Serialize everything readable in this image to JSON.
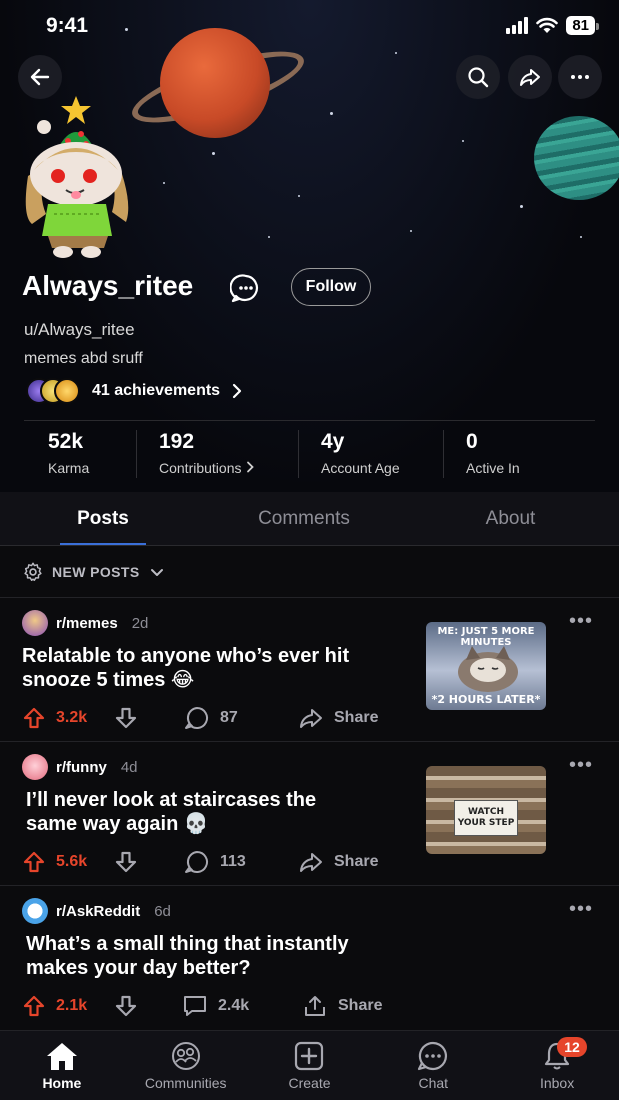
{
  "status_bar": {
    "time": "9:41",
    "battery": "81"
  },
  "profile": {
    "username": "Always_ritee",
    "handle": "u/Always_ritee",
    "bio": "memes abd sruff",
    "achievements_label": "41 achievements",
    "follow_label": "Follow"
  },
  "stats": [
    {
      "value": "52k",
      "label": "Karma"
    },
    {
      "value": "192",
      "label": "Contributions"
    },
    {
      "value": "4y",
      "label": "Account Age"
    },
    {
      "value": "0",
      "label": "Active In"
    }
  ],
  "tabs": [
    "Posts",
    "Comments",
    "About"
  ],
  "sort_label": "NEW POSTS",
  "posts": [
    {
      "subreddit": "r/memes",
      "age": "2d",
      "title": "Relatable to anyone who’s ever hit snooze 5 times 😂",
      "upvotes": "3.2k",
      "comments": "87",
      "share": "Share",
      "thumb_top": "ME: JUST 5 MORE MINUTES",
      "thumb_bottom": "*2 HOURS LATER*"
    },
    {
      "subreddit": "r/funny",
      "age": "4d",
      "title": "I’ll never look at staircases the same way again 💀",
      "upvotes": "5.6k",
      "comments": "113",
      "share": "Share",
      "thumb_sign": "WATCH YOUR STEP"
    },
    {
      "subreddit": "r/AskReddit",
      "age": "6d",
      "title": "What’s a small thing that instantly makes your day better?",
      "upvotes": "2.1k",
      "comments": "2.4k",
      "share": "Share"
    }
  ],
  "bottom_nav": [
    {
      "label": "Home",
      "icon": "home-icon"
    },
    {
      "label": "Communities",
      "icon": "communities-icon"
    },
    {
      "label": "Create",
      "icon": "plus-square-icon"
    },
    {
      "label": "Chat",
      "icon": "chat-bubble-icon"
    },
    {
      "label": "Inbox",
      "icon": "bell-icon",
      "badge": "12"
    }
  ],
  "colors": {
    "upvote": "#e6452b",
    "tab_underline": "#3a6fd8",
    "background": "#0b0b0d"
  }
}
